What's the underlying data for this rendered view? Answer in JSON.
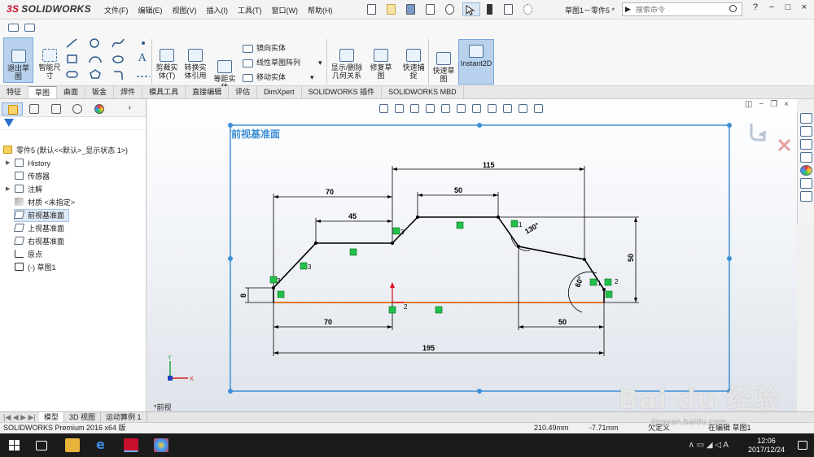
{
  "app": {
    "name": "SOLIDWORKS",
    "logo_mark": "3S",
    "doc_title": "草图1－零件5 *"
  },
  "menu": [
    "文件(F)",
    "编辑(E)",
    "视图(V)",
    "插入(I)",
    "工具(T)",
    "窗口(W)",
    "帮助(H)"
  ],
  "search": {
    "placeholder": "搜索命令"
  },
  "window_controls": [
    "?",
    "−",
    "□",
    "×"
  ],
  "ribbon": {
    "exit_sketch": "退出草\n图",
    "smart_dim": "智能尺\n寸",
    "trim": "剪裁实\n体(T)",
    "convert": "转换实\n体引用",
    "offset": "等距实\n体",
    "mirror": "镜向实体",
    "linear_pattern": "线性草图阵列",
    "move": "移动实体",
    "show_delete": "显示/删除\n几何关系",
    "repair": "修复草\n图",
    "quick_snap": "快速捕\n捉",
    "rapid_sketch": "快速草\n图",
    "instant2d": "Instant2D"
  },
  "tabs": [
    {
      "label": "特征",
      "active": false
    },
    {
      "label": "草图",
      "active": true
    },
    {
      "label": "曲面",
      "active": false
    },
    {
      "label": "钣金",
      "active": false
    },
    {
      "label": "焊件",
      "active": false
    },
    {
      "label": "模具工具",
      "active": false
    },
    {
      "label": "直接编辑",
      "active": false
    },
    {
      "label": "评估",
      "active": false
    },
    {
      "label": "DimXpert",
      "active": false
    },
    {
      "label": "SOLIDWORKS 插件",
      "active": false
    },
    {
      "label": "SOLIDWORKS MBD",
      "active": false
    }
  ],
  "tree": {
    "root": "零件5 (默认<<默认>_显示状态 1>)",
    "items": [
      {
        "label": "History",
        "icon": "history-icon",
        "expand": true,
        "selected": false
      },
      {
        "label": "传感器",
        "icon": "sensor-icon",
        "expand": false,
        "selected": false
      },
      {
        "label": "注解",
        "icon": "annotation-icon",
        "expand": true,
        "selected": false
      },
      {
        "label": "材质 <未指定>",
        "icon": "material-icon",
        "expand": false,
        "selected": false
      },
      {
        "label": "前视基准面",
        "icon": "plane-icon",
        "expand": false,
        "selected": true
      },
      {
        "label": "上视基准面",
        "icon": "plane-icon",
        "expand": false,
        "selected": false
      },
      {
        "label": "右视基准面",
        "icon": "plane-icon",
        "expand": false,
        "selected": false
      },
      {
        "label": "原点",
        "icon": "origin-icon",
        "expand": false,
        "selected": false
      },
      {
        "label": "(-) 草图1",
        "icon": "sketch-icon",
        "expand": false,
        "selected": false
      }
    ]
  },
  "graphics": {
    "plane_label": "前视基准面",
    "view_label": "*前视",
    "dimensions": [
      "115",
      "70",
      "50",
      "45",
      "130°",
      "50",
      "60°",
      "8",
      "70",
      "50",
      "195"
    ],
    "relations": [
      "3",
      "3",
      "1",
      "1",
      "2",
      "3",
      "2"
    ],
    "triad": {
      "x": "X",
      "y": "Y"
    },
    "colors": {
      "sketch": "#000000",
      "construction": "#e07a1e",
      "plane": "#3d8fd6",
      "relation": "#22c04a"
    }
  },
  "bottom_tabs": [
    {
      "label": "模型",
      "active": true
    },
    {
      "label": "3D 视图",
      "active": false
    },
    {
      "label": "运动算例 1",
      "active": false
    }
  ],
  "status": {
    "product": "SOLIDWORKS Premium 2016 x64 版",
    "x": "210.49mm",
    "y": "-7.71mm",
    "state": "欠定义",
    "mode": "在编辑 草图1"
  },
  "taskbar": {
    "time": "12:06",
    "date": "2017/12/24",
    "ime": "A"
  },
  "watermark": {
    "text": "Bai du 经验",
    "sub": "jingyan.baidu.com"
  }
}
